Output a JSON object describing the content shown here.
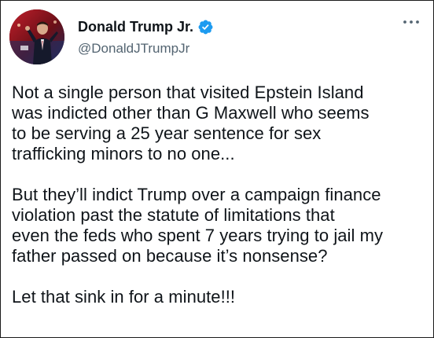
{
  "author": {
    "display_name": "Donald Trump Jr.",
    "handle": "@DonaldJTrumpJr",
    "verified": true,
    "verified_color": "#1d9bf0"
  },
  "avatar_icon": "profile-photo",
  "more_icon": "more-options-icon",
  "tweet": {
    "paragraphs": [
      "Not a single person that visited Epstein Island\nwas indicted other than G Maxwell who seems\nto be serving a 25 year sentence for sex\ntrafficking minors to no one...",
      "But they’ll indict Trump over a campaign finance\nviolation past the statute of limitations that\neven the feds who spent 7 years trying to jail my\nfather passed on because it’s nonsense?",
      "Let that sink in for a minute!!!"
    ]
  },
  "colors": {
    "text": "#0f1419",
    "secondary_text": "#536471",
    "frame_border": "#1b1b1b"
  }
}
